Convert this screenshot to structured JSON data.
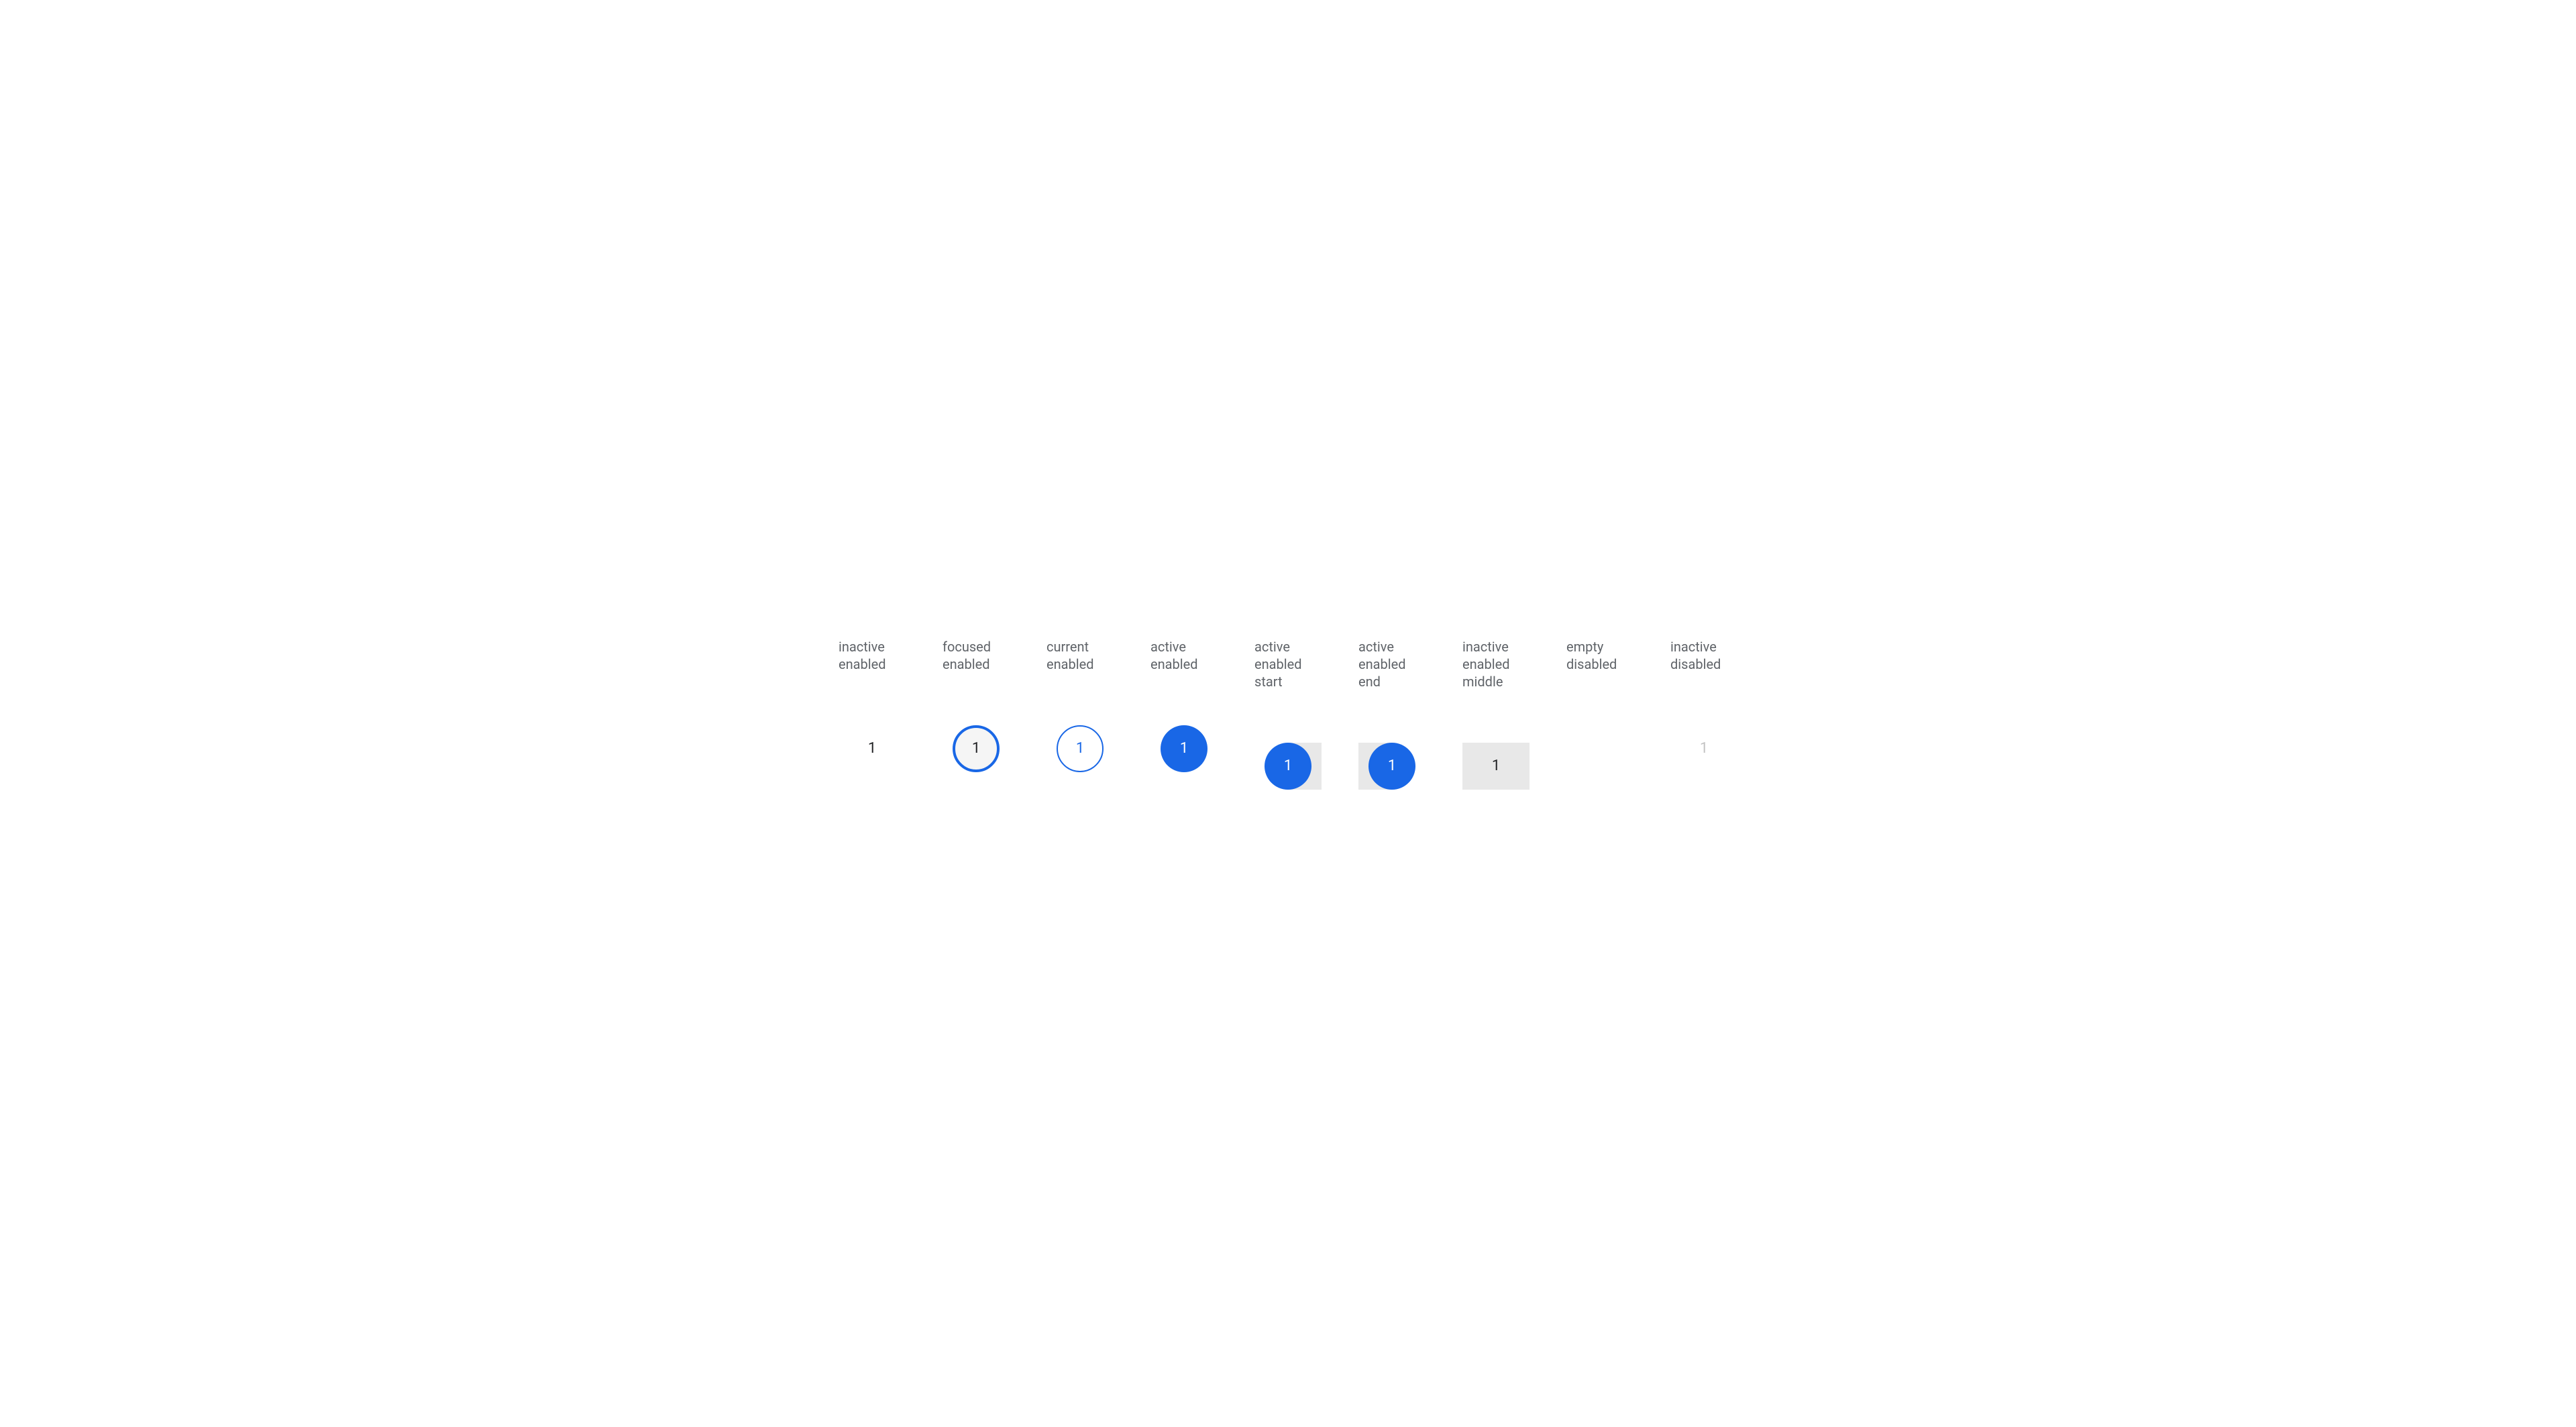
{
  "states": [
    {
      "label": "inactive\nenabled",
      "value": "1",
      "variant": "inactive-enabled",
      "interactable": true,
      "range": null
    },
    {
      "label": "focused\nenabled",
      "value": "1",
      "variant": "focused-enabled",
      "interactable": true,
      "range": null
    },
    {
      "label": "current\nenabled",
      "value": "1",
      "variant": "current-enabled",
      "interactable": true,
      "range": null
    },
    {
      "label": "active\nenabled",
      "value": "1",
      "variant": "active-enabled",
      "interactable": true,
      "range": null
    },
    {
      "label": "active\nenabled\nstart",
      "value": "1",
      "variant": "active-enabled",
      "interactable": true,
      "range": "start"
    },
    {
      "label": "active\nenabled\nend",
      "value": "1",
      "variant": "active-enabled",
      "interactable": true,
      "range": "end"
    },
    {
      "label": "inactive\nenabled\nmiddle",
      "value": "1",
      "variant": "inactive-enabled-middle",
      "interactable": true,
      "range": "middle"
    },
    {
      "label": "empty\ndisabled",
      "value": "",
      "variant": "empty-disabled",
      "interactable": false,
      "range": null
    },
    {
      "label": "inactive\ndisabled",
      "value": "1",
      "variant": "inactive-disabled",
      "interactable": false,
      "range": null
    }
  ],
  "colors": {
    "primary": "#1967e6",
    "text": "#202124",
    "muted": "#5f6368",
    "disabled": "#c4c4c4",
    "range_bg": "#e8e8e8",
    "focus_fill": "#f5f5f5"
  }
}
